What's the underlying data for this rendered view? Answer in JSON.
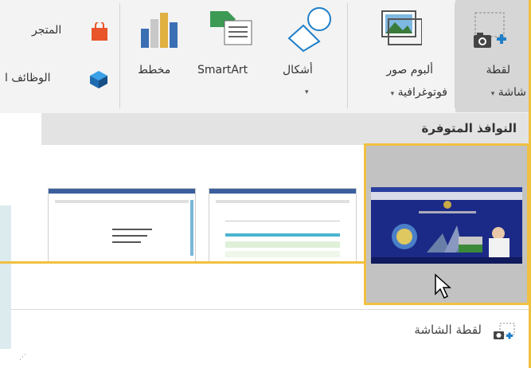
{
  "ribbon": {
    "screenshot_label_line1": "لقطة",
    "screenshot_label_line2": "شاشة",
    "album_label_line1": "ألبوم صور",
    "album_label_line2": "فوتوغرافية",
    "shapes_label": "أشكال",
    "smartart_label": "SmartArt",
    "chart_label": "مخطط",
    "store_label": "المتجر",
    "addins_label": "الوظائف ا",
    "caret": "▾"
  },
  "dropdown": {
    "available_windows_title": "النوافذ المتوفرة",
    "screen_clipping_label": "لقطة الشاشة",
    "grip": "⋰"
  },
  "colors": {
    "highlight": "#f0c040",
    "ribbon_bg": "#f3f3f3",
    "selected_btn_bg": "#d6d6d6"
  }
}
